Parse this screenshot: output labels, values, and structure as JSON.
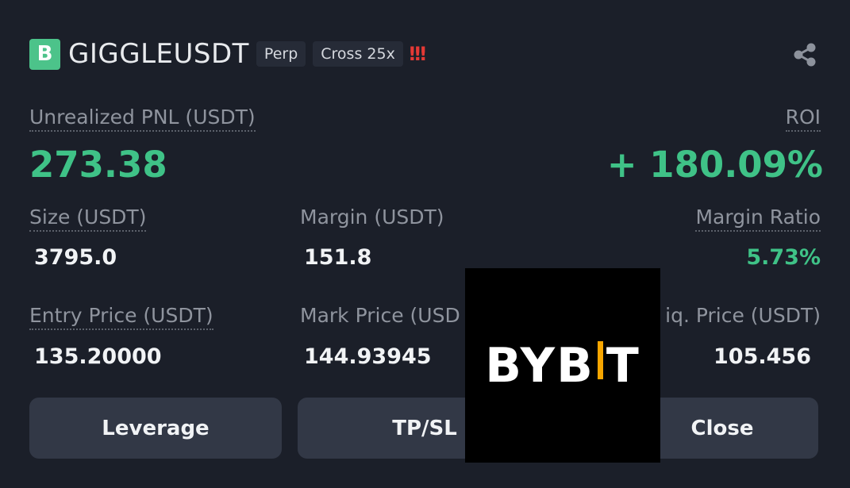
{
  "header": {
    "coin_letter": "B",
    "symbol": "GIGGLEUSDT",
    "tags": [
      "Perp",
      "Cross 25x"
    ],
    "alert": "!!!",
    "share_icon": "share-icon"
  },
  "pnl": {
    "label": "Unrealized PNL (USDT)",
    "value": "273.38",
    "roi_label": "ROI",
    "roi_value": "+ 180.09%"
  },
  "stats_row1": {
    "size_label": "Size (USDT)",
    "size_value": "3795.0",
    "margin_label": "Margin (USDT)",
    "margin_value": "151.8",
    "ratio_label": "Margin Ratio",
    "ratio_value": "5.73%"
  },
  "stats_row2": {
    "entry_label": "Entry Price (USDT)",
    "entry_value": "135.20000",
    "mark_label": "Mark Price (USD",
    "mark_value": "144.93945",
    "liq_label": "iq. Price (USDT)",
    "liq_value": "105.456"
  },
  "buttons": {
    "leverage": "Leverage",
    "tpsl": "TP/SL",
    "close": "Close"
  },
  "watermark": {
    "logo_text_left": "BYB",
    "logo_text_right": "T"
  },
  "colors": {
    "background": "#1b1f29",
    "profit_green": "#3fc287",
    "badge_green": "#4cc38a",
    "brand_orange": "#f7a600",
    "alert_red": "#e53935"
  }
}
